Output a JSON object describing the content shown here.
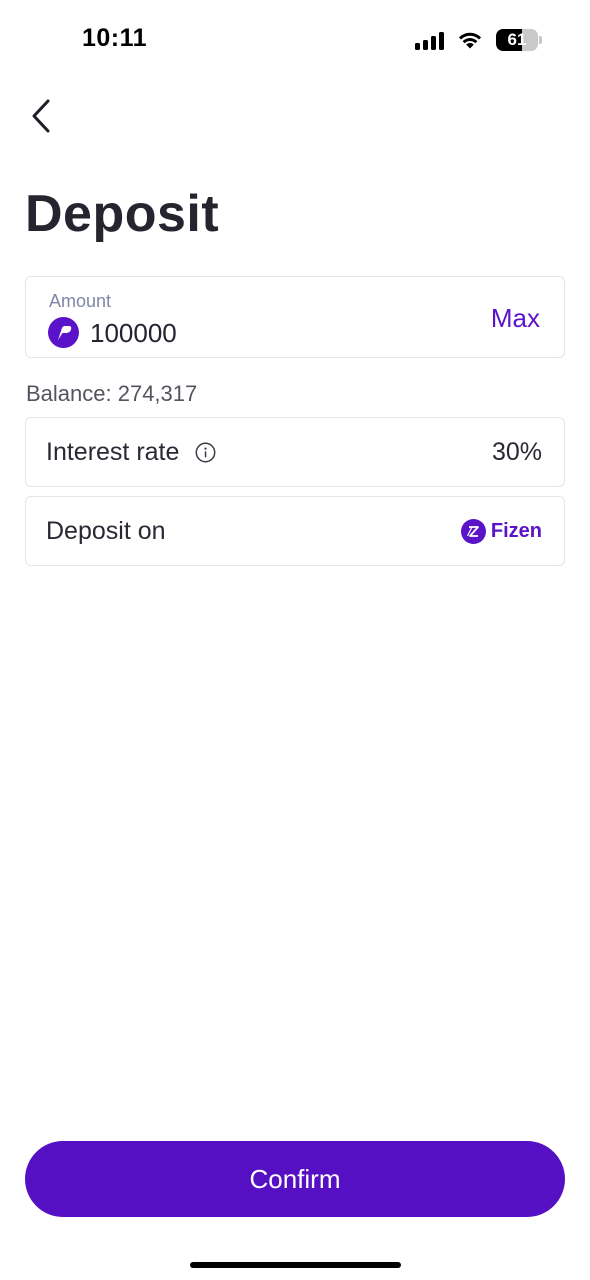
{
  "status_bar": {
    "time": "10:11",
    "battery_level": "61",
    "icons": [
      "signal-icon",
      "wifi-icon",
      "battery-icon"
    ]
  },
  "nav": {
    "back_icon": "chevron-left-icon"
  },
  "page": {
    "title": "Deposit"
  },
  "amount": {
    "label": "Amount",
    "value": "100000",
    "token_icon": "token-icon",
    "max_label": "Max"
  },
  "balance": {
    "text": "Balance: 274,317"
  },
  "interest": {
    "label": "Interest rate",
    "value": "30%",
    "info_icon": "info-icon"
  },
  "deposit_on": {
    "label": "Deposit on",
    "brand_name": "Fizen",
    "brand_icon": "fizen-logo-icon"
  },
  "actions": {
    "confirm_label": "Confirm"
  },
  "colors": {
    "accent": "#5510c4",
    "text": "#26242f",
    "muted_label": "#7f86a8",
    "border": "#e6e6ea"
  }
}
